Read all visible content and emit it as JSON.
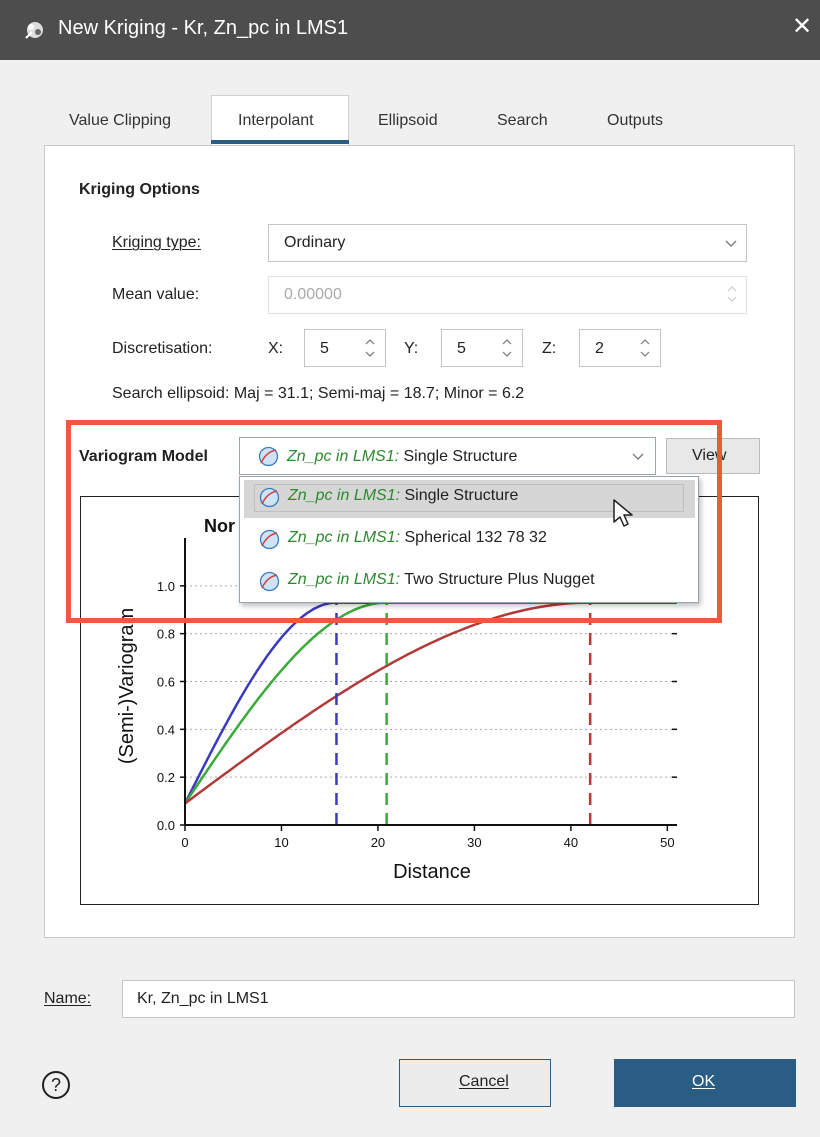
{
  "window": {
    "title": "New Kriging - Kr, Zn_pc in LMS1",
    "close_label": "✕",
    "icon": "kriging-app-icon"
  },
  "tabs": [
    {
      "label": "Value Clipping",
      "active": false
    },
    {
      "label": "Interpolant",
      "active": true
    },
    {
      "label": "Ellipsoid",
      "active": false
    },
    {
      "label": "Search",
      "active": false
    },
    {
      "label": "Outputs",
      "active": false
    }
  ],
  "kriging_options": {
    "heading": "Kriging Options",
    "type_label": "Kriging type:",
    "type_value": "Ordinary",
    "mean_label": "Mean value:",
    "mean_value": "0.00000",
    "discretisation_label": "Discretisation:",
    "x_label": "X:",
    "x_value": "5",
    "y_label": "Y:",
    "y_value": "5",
    "z_label": "Z:",
    "z_value": "2",
    "search_ellipsoid": "Search ellipsoid:  Maj = 31.1; Semi-maj = 18.7; Minor = 6.2"
  },
  "variogram": {
    "label": "Variogram Model",
    "selected_prefix": "Zn_pc in LMS1:",
    "selected_name": " Single Structure",
    "view_button": "View",
    "options": [
      {
        "prefix": "Zn_pc in LMS1:",
        "name": " Single Structure"
      },
      {
        "prefix": "Zn_pc in LMS1:",
        "name": " Spherical 132 78 32"
      },
      {
        "prefix": "Zn_pc in LMS1:",
        "name": " Two Structure Plus Nugget"
      }
    ],
    "highlight_color": "#ee5840"
  },
  "chart_data": {
    "type": "line",
    "title": "Nor",
    "xlabel": "Distance",
    "ylabel": "(Semi-)Variogram",
    "xlim": [
      0,
      51
    ],
    "ylim": [
      0,
      1.2
    ],
    "x_ticks": [
      "0",
      "10",
      "20",
      "30",
      "40",
      "50"
    ],
    "y_ticks": [
      "0.0",
      "0.2",
      "0.4",
      "0.6",
      "0.8",
      "1.0"
    ],
    "grid": "horizontal dotted",
    "series": [
      {
        "color": "#3a3abf",
        "nugget": 0.09,
        "sill": 0.93,
        "range": 15.7
      },
      {
        "color": "#3aaa3a",
        "nugget": 0.09,
        "sill": 0.93,
        "range": 20.9
      },
      {
        "color": "#b23a3a",
        "nugget": 0.09,
        "sill": 0.93,
        "range": 42.0
      }
    ]
  },
  "name_field": {
    "label": "Name:",
    "value": "Kr, Zn_pc in LMS1"
  },
  "footer": {
    "help_label": "?",
    "cancel_label": "Cancel",
    "ok_label": "OK"
  },
  "colors": {
    "accent": "#2a5d84",
    "titlebar": "#4d4d4d",
    "ok_button": "#2a5d84"
  }
}
